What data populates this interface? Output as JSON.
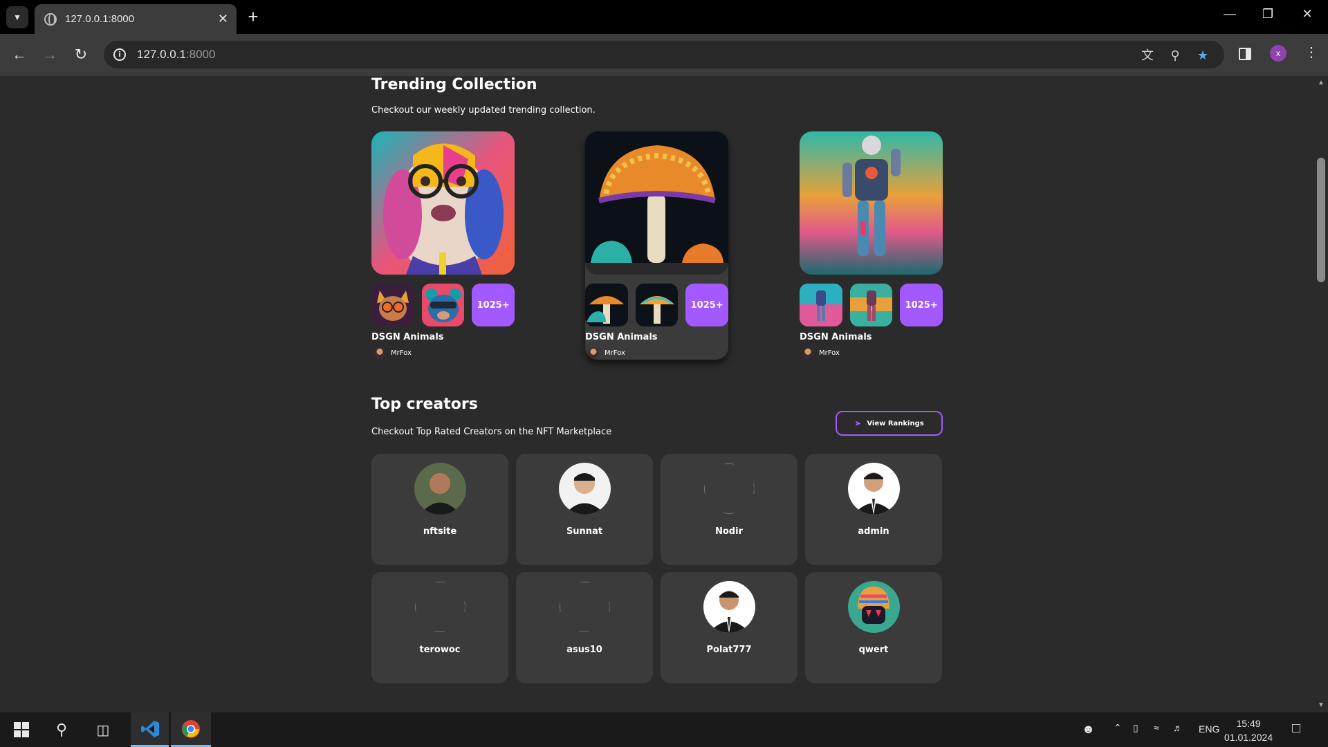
{
  "browser": {
    "tab_title": "127.0.0.1:8000",
    "url_host": "127.0.0.1",
    "url_port": ":8000",
    "profile_initial": "x"
  },
  "trending": {
    "title": "Trending Collection",
    "subtitle": "Checkout our weekly updated trending collection.",
    "collections": [
      {
        "name": "DSGN Animals",
        "artist": "MrFox",
        "count": "1025+",
        "theme": "dog"
      },
      {
        "name": "DSGN Animals",
        "artist": "MrFox",
        "count": "1025+",
        "theme": "mushroom"
      },
      {
        "name": "DSGN Animals",
        "artist": "MrFox",
        "count": "1025+",
        "theme": "robot"
      }
    ]
  },
  "creators": {
    "title": "Top creators",
    "subtitle": "Checkout Top Rated Creators on the NFT Marketplace",
    "rankings_button": "View Rankings",
    "list": [
      {
        "name": "nftsite",
        "avatar": "photo-dark"
      },
      {
        "name": "Sunnat",
        "avatar": "photo-light"
      },
      {
        "name": "Nodir",
        "avatar": "none"
      },
      {
        "name": "admin",
        "avatar": "photo-suit"
      },
      {
        "name": "terowoc",
        "avatar": "none"
      },
      {
        "name": "asus10",
        "avatar": "none"
      },
      {
        "name": "Polat777",
        "avatar": "photo-suit"
      },
      {
        "name": "qwert",
        "avatar": "robot-art"
      }
    ]
  },
  "taskbar": {
    "language": "ENG",
    "time": "15:49",
    "date": "01.01.2024"
  },
  "colors": {
    "accent": "#a259ff",
    "page_bg": "#2b2b2b",
    "card_bg": "#3b3b3b"
  }
}
